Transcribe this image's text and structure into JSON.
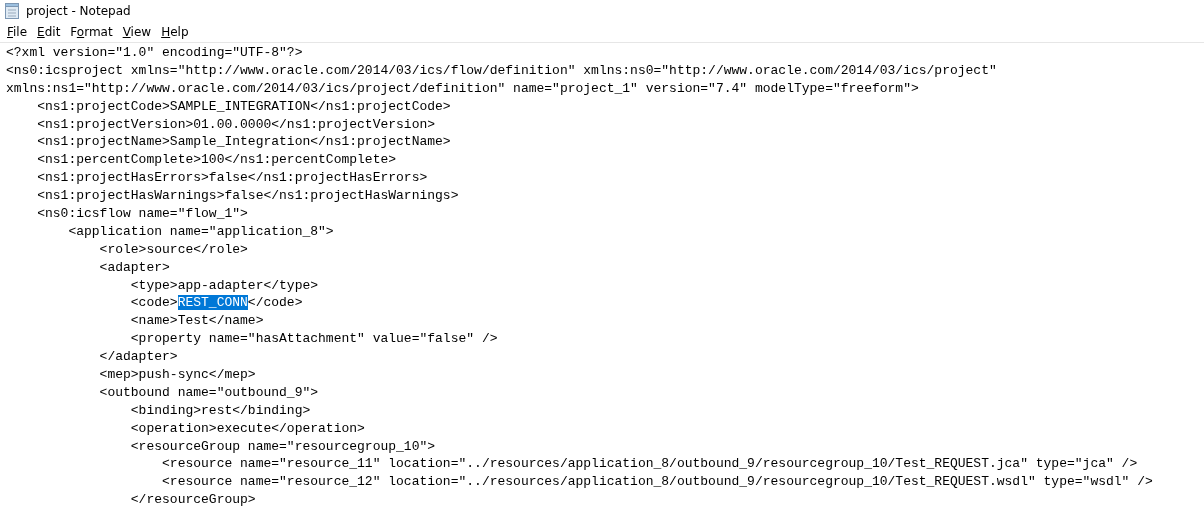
{
  "window": {
    "title": "project - Notepad"
  },
  "menu": [
    {
      "key": "F",
      "after": "ile"
    },
    {
      "key": "E",
      "after": "dit"
    },
    {
      "before": "F",
      "key": "o",
      "after": "rmat"
    },
    {
      "key": "V",
      "after": "iew"
    },
    {
      "key": "H",
      "after": "elp"
    }
  ],
  "editor": {
    "lines": [
      [
        {
          "text": "<?xml version=\"1.0\" encoding=\"UTF-8\"?>",
          "selected": false
        }
      ],
      [
        {
          "text": "<ns0:icsproject xmlns=\"http://www.oracle.com/2014/03/ics/flow/definition\" xmlns:ns0=\"http://www.oracle.com/2014/03/ics/project\"",
          "selected": false
        }
      ],
      [
        {
          "text": "xmlns:ns1=\"http://www.oracle.com/2014/03/ics/project/definition\" name=\"project_1\" version=\"7.4\" modelType=\"freeform\">",
          "selected": false
        }
      ],
      [
        {
          "text": "    <ns1:projectCode>SAMPLE_INTEGRATION</ns1:projectCode>",
          "selected": false
        }
      ],
      [
        {
          "text": "    <ns1:projectVersion>01.00.0000</ns1:projectVersion>",
          "selected": false
        }
      ],
      [
        {
          "text": "    <ns1:projectName>Sample_Integration</ns1:projectName>",
          "selected": false
        }
      ],
      [
        {
          "text": "    <ns1:percentComplete>100</ns1:percentComplete>",
          "selected": false
        }
      ],
      [
        {
          "text": "    <ns1:projectHasErrors>false</ns1:projectHasErrors>",
          "selected": false
        }
      ],
      [
        {
          "text": "    <ns1:projectHasWarnings>false</ns1:projectHasWarnings>",
          "selected": false
        }
      ],
      [
        {
          "text": "    <ns0:icsflow name=\"flow_1\">",
          "selected": false
        }
      ],
      [
        {
          "text": "        <application name=\"application_8\">",
          "selected": false
        }
      ],
      [
        {
          "text": "            <role>source</role>",
          "selected": false
        }
      ],
      [
        {
          "text": "            <adapter>",
          "selected": false
        }
      ],
      [
        {
          "text": "                <type>app-adapter</type>",
          "selected": false
        }
      ],
      [
        {
          "text": "                <code>",
          "selected": false
        },
        {
          "text": "REST_CONN",
          "selected": true
        },
        {
          "text": "</code>",
          "selected": false
        }
      ],
      [
        {
          "text": "                <name>Test</name>",
          "selected": false
        }
      ],
      [
        {
          "text": "                <property name=\"hasAttachment\" value=\"false\" />",
          "selected": false
        }
      ],
      [
        {
          "text": "            </adapter>",
          "selected": false
        }
      ],
      [
        {
          "text": "            <mep>push-sync</mep>",
          "selected": false
        }
      ],
      [
        {
          "text": "            <outbound name=\"outbound_9\">",
          "selected": false
        }
      ],
      [
        {
          "text": "                <binding>rest</binding>",
          "selected": false
        }
      ],
      [
        {
          "text": "                <operation>execute</operation>",
          "selected": false
        }
      ],
      [
        {
          "text": "                <resourceGroup name=\"resourcegroup_10\">",
          "selected": false
        }
      ],
      [
        {
          "text": "                    <resource name=\"resource_11\" location=\"../resources/application_8/outbound_9/resourcegroup_10/Test_REQUEST.jca\" type=\"jca\" />",
          "selected": false
        }
      ],
      [
        {
          "text": "                    <resource name=\"resource_12\" location=\"../resources/application_8/outbound_9/resourcegroup_10/Test_REQUEST.wsdl\" type=\"wsdl\" />",
          "selected": false
        }
      ],
      [
        {
          "text": "                </resourceGroup>",
          "selected": false
        }
      ]
    ]
  }
}
